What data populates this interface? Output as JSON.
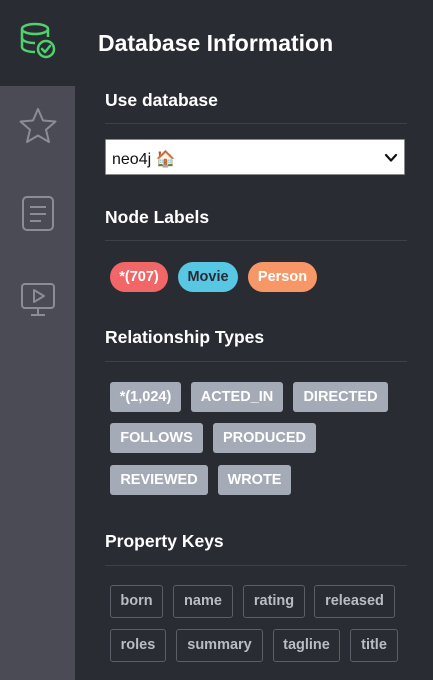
{
  "sidebar": {
    "items": [
      {
        "icon": "database-icon",
        "active": true,
        "color": "#4fd16c"
      },
      {
        "icon": "star-icon",
        "active": false
      },
      {
        "icon": "document-icon",
        "active": false
      },
      {
        "icon": "monitor-play-icon",
        "active": false
      }
    ]
  },
  "drawer": {
    "title": "Database Information",
    "use_database": {
      "heading": "Use database",
      "selected": "neo4j 🏠"
    },
    "node_labels": {
      "heading": "Node Labels",
      "items": [
        {
          "label": "*(707)",
          "bg": "#f16667",
          "fg": "#ffffff"
        },
        {
          "label": "Movie",
          "bg": "#57c7e3",
          "fg": "#2a2c34"
        },
        {
          "label": "Person",
          "bg": "#f79767",
          "fg": "#ffffff"
        }
      ]
    },
    "relationship_types": {
      "heading": "Relationship Types",
      "items": [
        "*(1,024)",
        "ACTED_IN",
        "DIRECTED",
        "FOLLOWS",
        "PRODUCED",
        "REVIEWED",
        "WROTE"
      ]
    },
    "property_keys": {
      "heading": "Property Keys",
      "items": [
        "born",
        "name",
        "rating",
        "released",
        "roles",
        "summary",
        "tagline",
        "title"
      ]
    }
  }
}
